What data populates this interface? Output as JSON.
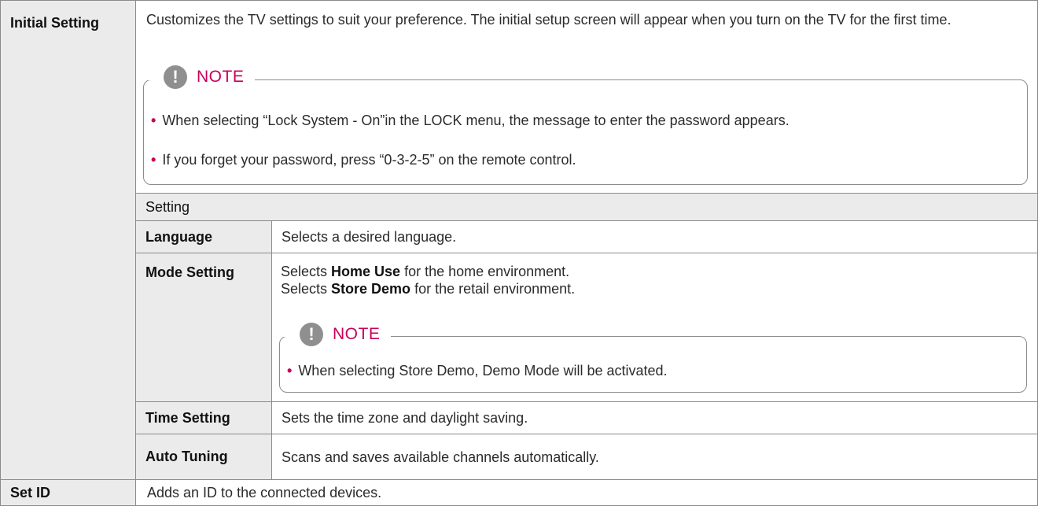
{
  "rows": {
    "initial_setting": {
      "label": "Initial Setting",
      "description": "Customizes the TV settings to suit your preference. The initial setup screen will appear when you turn on the TV for the first time.",
      "note": {
        "title": "NOTE",
        "items": [
          "When selecting “Lock System - On”in the LOCK menu, the message to enter the password appears.",
          "If you forget your password, press “0-3-2-5” on the remote control."
        ]
      }
    },
    "setting_header": {
      "label": "Setting"
    },
    "language": {
      "label": "Language",
      "description": "Selects a desired language."
    },
    "mode_setting": {
      "label": "Mode Setting",
      "line1": {
        "pre": "Selects ",
        "bold": "Home Use",
        "post": " for the home environment."
      },
      "line2": {
        "pre": "Selects ",
        "bold": "Store Demo",
        "post": " for the retail environment."
      },
      "note": {
        "title": "NOTE",
        "items": [
          "When selecting Store Demo, Demo Mode will be activated."
        ]
      }
    },
    "time_setting": {
      "label": "Time Setting",
      "description": "Sets the time zone and daylight saving."
    },
    "auto_tuning": {
      "label": "Auto Tuning",
      "description": "Scans and saves available channels automatically."
    },
    "set_id": {
      "label": "Set ID",
      "description": "Adds an ID to the connected devices."
    }
  },
  "colors": {
    "accent": "#c8005a",
    "label_bg": "#ebebeb",
    "border": "#8a8a8a",
    "icon": "#8f8f8f"
  }
}
